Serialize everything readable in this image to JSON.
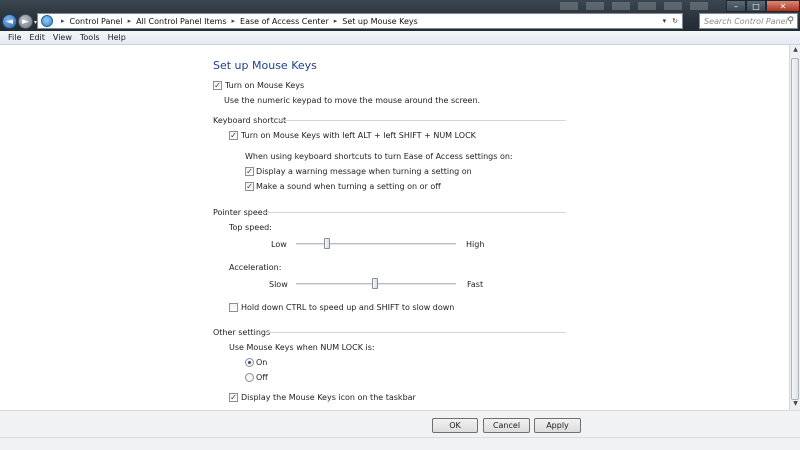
{
  "window": {
    "minimize_glyph": "–",
    "maximize_glyph": "□",
    "close_glyph": "✕"
  },
  "nav": {
    "back_glyph": "◄",
    "forward_glyph": "►",
    "dropdown_glyph": "▾"
  },
  "address": {
    "separator": "▸",
    "breadcrumbs": [
      "Control Panel",
      "All Control Panel Items",
      "Ease of Access Center",
      "Set up Mouse Keys"
    ],
    "dropdown_glyph": "▾",
    "refresh_glyph": "↻"
  },
  "search": {
    "placeholder": "Search Control Panel",
    "icon_glyph": "⚲"
  },
  "menu": {
    "items": [
      "File",
      "Edit",
      "View",
      "Tools",
      "Help"
    ]
  },
  "page": {
    "title": "Set up Mouse Keys",
    "check_glyph": "✓",
    "turn_on": {
      "label": "Turn on Mouse Keys",
      "checked": true,
      "description": "Use the numeric keypad to move the mouse around the screen."
    },
    "keyboard_shortcut": {
      "heading": "Keyboard shortcut",
      "shortcut_label": "Turn on Mouse Keys with left ALT + left SHIFT + NUM LOCK",
      "shortcut_checked": true,
      "when_using": "When using keyboard shortcuts to turn Ease of Access settings on:",
      "warning_label": "Display a warning message when turning a setting on",
      "warning_checked": true,
      "sound_label": "Make a sound when turning a setting on or off",
      "sound_checked": true
    },
    "pointer_speed": {
      "heading": "Pointer speed",
      "top_speed_label": "Top speed:",
      "top_low": "Low",
      "top_high": "High",
      "top_speed_level": 0.2,
      "acceleration_label": "Acceleration:",
      "acc_slow": "Slow",
      "acc_fast": "Fast",
      "acceleration_level": 0.5,
      "ctrl_label": "Hold down CTRL to speed up and SHIFT to slow down",
      "ctrl_checked": false
    },
    "other": {
      "heading": "Other settings",
      "numlock_label": "Use Mouse Keys when NUM LOCK is:",
      "on_label": "On",
      "off_label": "Off",
      "selected": "On",
      "taskbar_label": "Display the Mouse Keys icon on the taskbar",
      "taskbar_checked": true
    }
  },
  "buttons": {
    "ok": "OK",
    "cancel": "Cancel",
    "apply": "Apply"
  },
  "colors": {
    "heading": "#1f3f8f"
  }
}
